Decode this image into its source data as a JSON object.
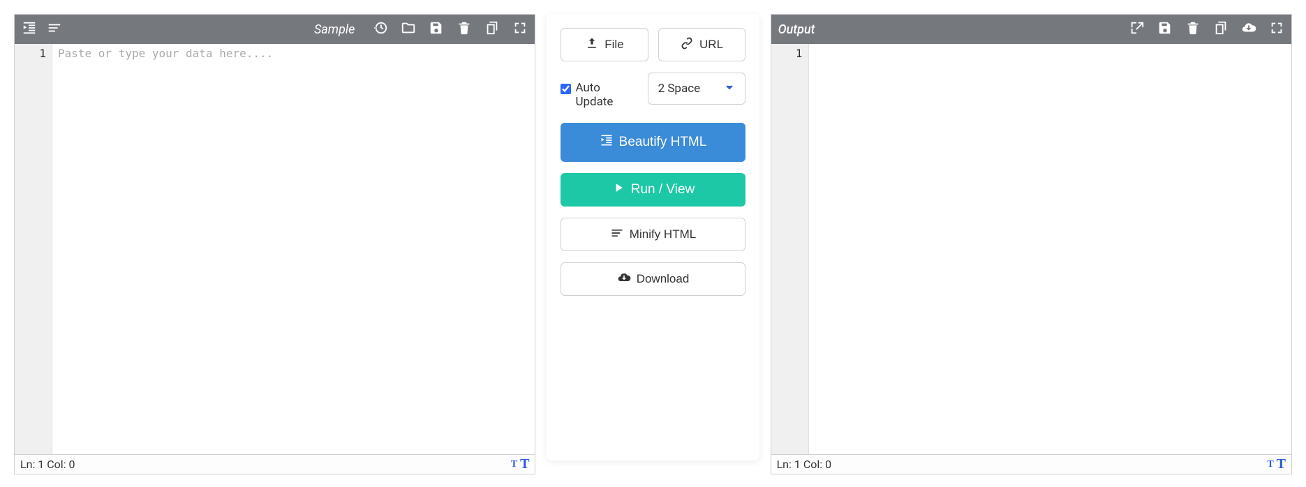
{
  "left": {
    "sample_label": "Sample",
    "placeholder": "Paste or type your data here....",
    "line_number": "1",
    "footer_status": "Ln: 1 Col: 0"
  },
  "center": {
    "file_label": "File",
    "url_label": "URL",
    "auto_update_label": "Auto Update",
    "auto_update_checked": true,
    "indent_select": "2 Space",
    "beautify_label": "Beautify HTML",
    "run_label": "Run / View",
    "minify_label": "Minify HTML",
    "download_label": "Download"
  },
  "right": {
    "title": "Output",
    "line_number": "1",
    "footer_status": "Ln: 1 Col: 0"
  }
}
